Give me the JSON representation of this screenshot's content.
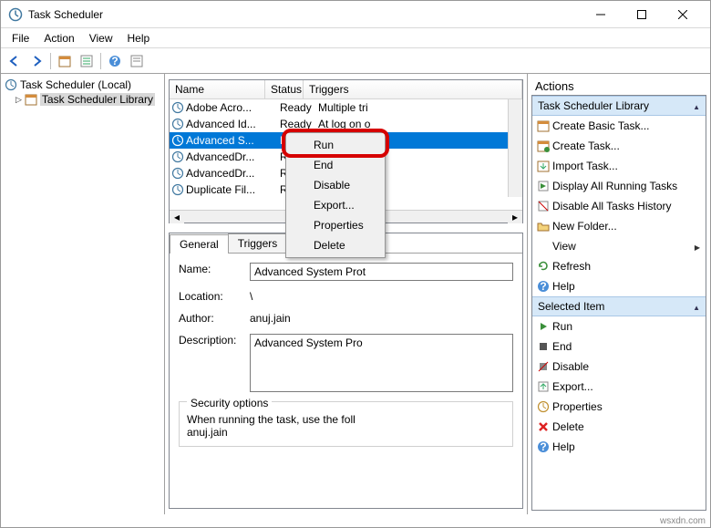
{
  "window": {
    "title": "Task Scheduler"
  },
  "menubar": [
    "File",
    "Action",
    "View",
    "Help"
  ],
  "tree": {
    "root": "Task Scheduler (Local)",
    "child": "Task Scheduler Library"
  },
  "task_list": {
    "columns": [
      "Name",
      "Status",
      "Triggers"
    ],
    "rows": [
      {
        "name": "Adobe Acro...",
        "status": "Ready",
        "triggers": "Multiple tri"
      },
      {
        "name": "Advanced Id...",
        "status": "Ready",
        "triggers": "At log on o"
      },
      {
        "name": "Advanced S...",
        "status": "Rea",
        "triggers": "",
        "selected": true
      },
      {
        "name": "AdvancedDr...",
        "status": "Rea",
        "triggers": ""
      },
      {
        "name": "AdvancedDr...",
        "status": "Rea",
        "triggers": ""
      },
      {
        "name": "Duplicate Fil...",
        "status": "Rea",
        "triggers": ""
      }
    ]
  },
  "context_menu": {
    "items": [
      "Run",
      "End",
      "Disable",
      "Export...",
      "Properties",
      "Delete"
    ]
  },
  "details": {
    "tabs": [
      "General",
      "Triggers",
      "A"
    ],
    "active_tab": "General",
    "name_label": "Name:",
    "name_value": "Advanced System Prot",
    "location_label": "Location:",
    "location_value": "\\",
    "author_label": "Author:",
    "author_value": "anuj.jain",
    "description_label": "Description:",
    "description_value": "Advanced System Pro",
    "security_legend": "Security options",
    "security_text1": "When running the task, use the foll",
    "security_text2": "anuj.jain"
  },
  "actions": {
    "title": "Actions",
    "section1_header": "Task Scheduler Library",
    "section1": [
      {
        "label": "Create Basic Task...",
        "icon": "calendar"
      },
      {
        "label": "Create Task...",
        "icon": "calendar-new"
      },
      {
        "label": "Import Task...",
        "icon": "import"
      },
      {
        "label": "Display All Running Tasks",
        "icon": "running"
      },
      {
        "label": "Disable All Tasks History",
        "icon": "disable-history"
      },
      {
        "label": "New Folder...",
        "icon": "folder"
      },
      {
        "label": "View",
        "icon": "",
        "submenu": true
      },
      {
        "label": "Refresh",
        "icon": "refresh"
      },
      {
        "label": "Help",
        "icon": "help"
      }
    ],
    "section2_header": "Selected Item",
    "section2": [
      {
        "label": "Run",
        "icon": "run"
      },
      {
        "label": "End",
        "icon": "end"
      },
      {
        "label": "Disable",
        "icon": "disable"
      },
      {
        "label": "Export...",
        "icon": "export"
      },
      {
        "label": "Properties",
        "icon": "properties"
      },
      {
        "label": "Delete",
        "icon": "delete"
      },
      {
        "label": "Help",
        "icon": "help"
      }
    ]
  },
  "watermark": "wsxdn.com"
}
